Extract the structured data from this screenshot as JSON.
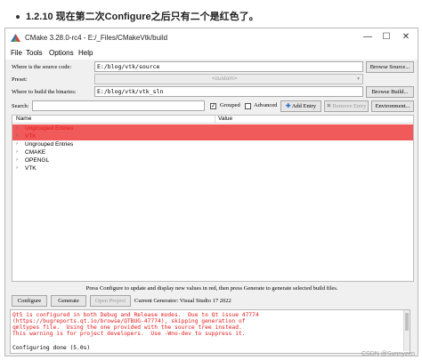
{
  "heading": {
    "number": "1.2.10",
    "text": "现在第二次Configure之后只有二个是红色了。"
  },
  "window": {
    "title": "CMake 3.28.0-rc4 - E:/_Files/CMakeVtk/build",
    "controls": {
      "minimize": "—",
      "maximize": "☐",
      "close": "✕"
    }
  },
  "menu": [
    "File",
    "Tools",
    "Options",
    "Help"
  ],
  "source": {
    "label": "Where is the source code:",
    "value": "E:/blog/vtk/source",
    "browse": "Browse Source..."
  },
  "preset": {
    "label": "Preset:",
    "value": "<custom>"
  },
  "build": {
    "label": "Where to build the binaries:",
    "value": "E:/blog/vtk/vtk_sln",
    "browse": "Browse Build..."
  },
  "search": {
    "label": "Search:",
    "value": ""
  },
  "options": {
    "grouped": "Grouped",
    "advanced": "Advanced",
    "add_entry": "Add Entry",
    "remove_entry": "Remove Entry",
    "environment": "Environment..."
  },
  "tree": {
    "columns": [
      "Name",
      "Value"
    ],
    "rows": [
      {
        "name": "Ungrouped Entries",
        "highlight": true
      },
      {
        "name": "VTK",
        "highlight": true
      },
      {
        "name": "Ungrouped Entries",
        "highlight": false
      },
      {
        "name": "CMAKE",
        "highlight": false
      },
      {
        "name": "OPENGL",
        "highlight": false
      },
      {
        "name": "VTK",
        "highlight": false
      }
    ]
  },
  "status_text": "Press Configure to update and display new values in red, then press Generate to generate selected build files.",
  "actions": {
    "configure": "Configure",
    "generate": "Generate",
    "open_project": "Open Project",
    "generator_label": "Current Generator: Visual Studio 17 2022"
  },
  "output": {
    "lines": [
      "Qt5 is configured in both Debug and Release modes.  Due to Qt issue 47774",
      "(https://bugreports.qt.io/browse/QTBUG-47774), skipping generation of",
      "qmltypes file.  Using the one provided with the source tree instead.",
      "This warning is for project developers.  Use -Wno-dev to suppress it."
    ],
    "done": "Configuring done (5.0s)"
  },
  "watermark": "CSDN @Sunnyzen",
  "colors": {
    "highlight": "#f05a5a",
    "warning_text": "#e11c1c"
  }
}
